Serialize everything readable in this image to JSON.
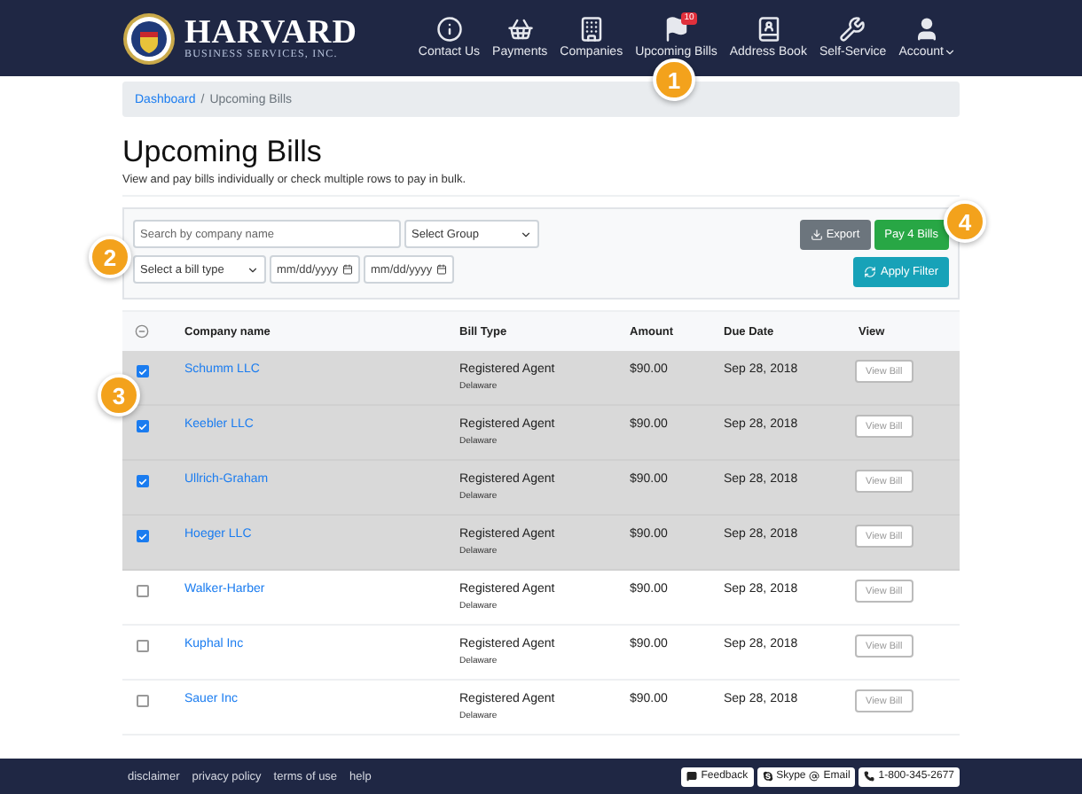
{
  "brand": {
    "name": "HARVARD",
    "tagline": "BUSINESS SERVICES, INC."
  },
  "nav": [
    {
      "kind": "info",
      "label": "Contact Us"
    },
    {
      "kind": "basket",
      "label": "Payments"
    },
    {
      "kind": "building",
      "label": "Companies"
    },
    {
      "kind": "flag",
      "label": "Upcoming Bills",
      "badge": "10"
    },
    {
      "kind": "book",
      "label": "Address Book"
    },
    {
      "kind": "wrench",
      "label": "Self-Service"
    },
    {
      "kind": "user",
      "label": "Account",
      "dropdown": true
    }
  ],
  "breadcrumb": [
    {
      "label": "Dashboard",
      "link": true
    },
    {
      "label": "Upcoming Bills",
      "link": false
    }
  ],
  "breadcrumb_separator": "/",
  "title": "Upcoming Bills",
  "subtitle": "View and pay bills individually or check multiple rows to pay in bulk.",
  "filters": {
    "search": {
      "placeholder": "Search by company name"
    },
    "group": {
      "value": "Select Group"
    },
    "bill_type": {
      "value": "Select a bill type"
    },
    "date_from": {
      "placeholder": "mm/dd/yyyy"
    },
    "date_to": {
      "placeholder": "mm/dd/yyyy"
    }
  },
  "actions": {
    "export": "Export",
    "pay": "Pay 4 Bills",
    "apply": "Apply Filter"
  },
  "table": {
    "select_all_partial": true,
    "columns": [
      "Company name",
      "Bill Type",
      "Amount",
      "Due Date",
      "View"
    ],
    "rows": [
      {
        "company": "Schumm LLC",
        "bill_type": "Registered Agent",
        "state": "Delaware",
        "amount": "$90.00",
        "due": "Sep 28, 2018",
        "action": "View Bill",
        "checked": true
      },
      {
        "company": "Keebler LLC",
        "bill_type": "Registered Agent",
        "state": "Delaware",
        "amount": "$90.00",
        "due": "Sep 28, 2018",
        "action": "View Bill",
        "checked": true
      },
      {
        "company": "Ullrich-Graham",
        "bill_type": "Registered Agent",
        "state": "Delaware",
        "amount": "$90.00",
        "due": "Sep 28, 2018",
        "action": "View Bill",
        "checked": true
      },
      {
        "company": "Hoeger LLC",
        "bill_type": "Registered Agent",
        "state": "Delaware",
        "amount": "$90.00",
        "due": "Sep 28, 2018",
        "action": "View Bill",
        "checked": true
      },
      {
        "company": "Walker-Harber",
        "bill_type": "Registered Agent",
        "state": "Delaware",
        "amount": "$90.00",
        "due": "Sep 28, 2018",
        "action": "View Bill",
        "checked": false
      },
      {
        "company": "Kuphal Inc",
        "bill_type": "Registered Agent",
        "state": "Delaware",
        "amount": "$90.00",
        "due": "Sep 28, 2018",
        "action": "View Bill",
        "checked": false
      },
      {
        "company": "Sauer Inc",
        "bill_type": "Registered Agent",
        "state": "Delaware",
        "amount": "$90.00",
        "due": "Sep 28, 2018",
        "action": "View Bill",
        "checked": false
      }
    ]
  },
  "footer": {
    "links": [
      "disclaimer",
      "privacy policy",
      "terms of use",
      "help"
    ],
    "feedback": "Feedback",
    "skype": "Skype",
    "email": "Email",
    "phone": "1-800-345-2677"
  },
  "callouts": [
    "1",
    "2",
    "3",
    "4"
  ]
}
